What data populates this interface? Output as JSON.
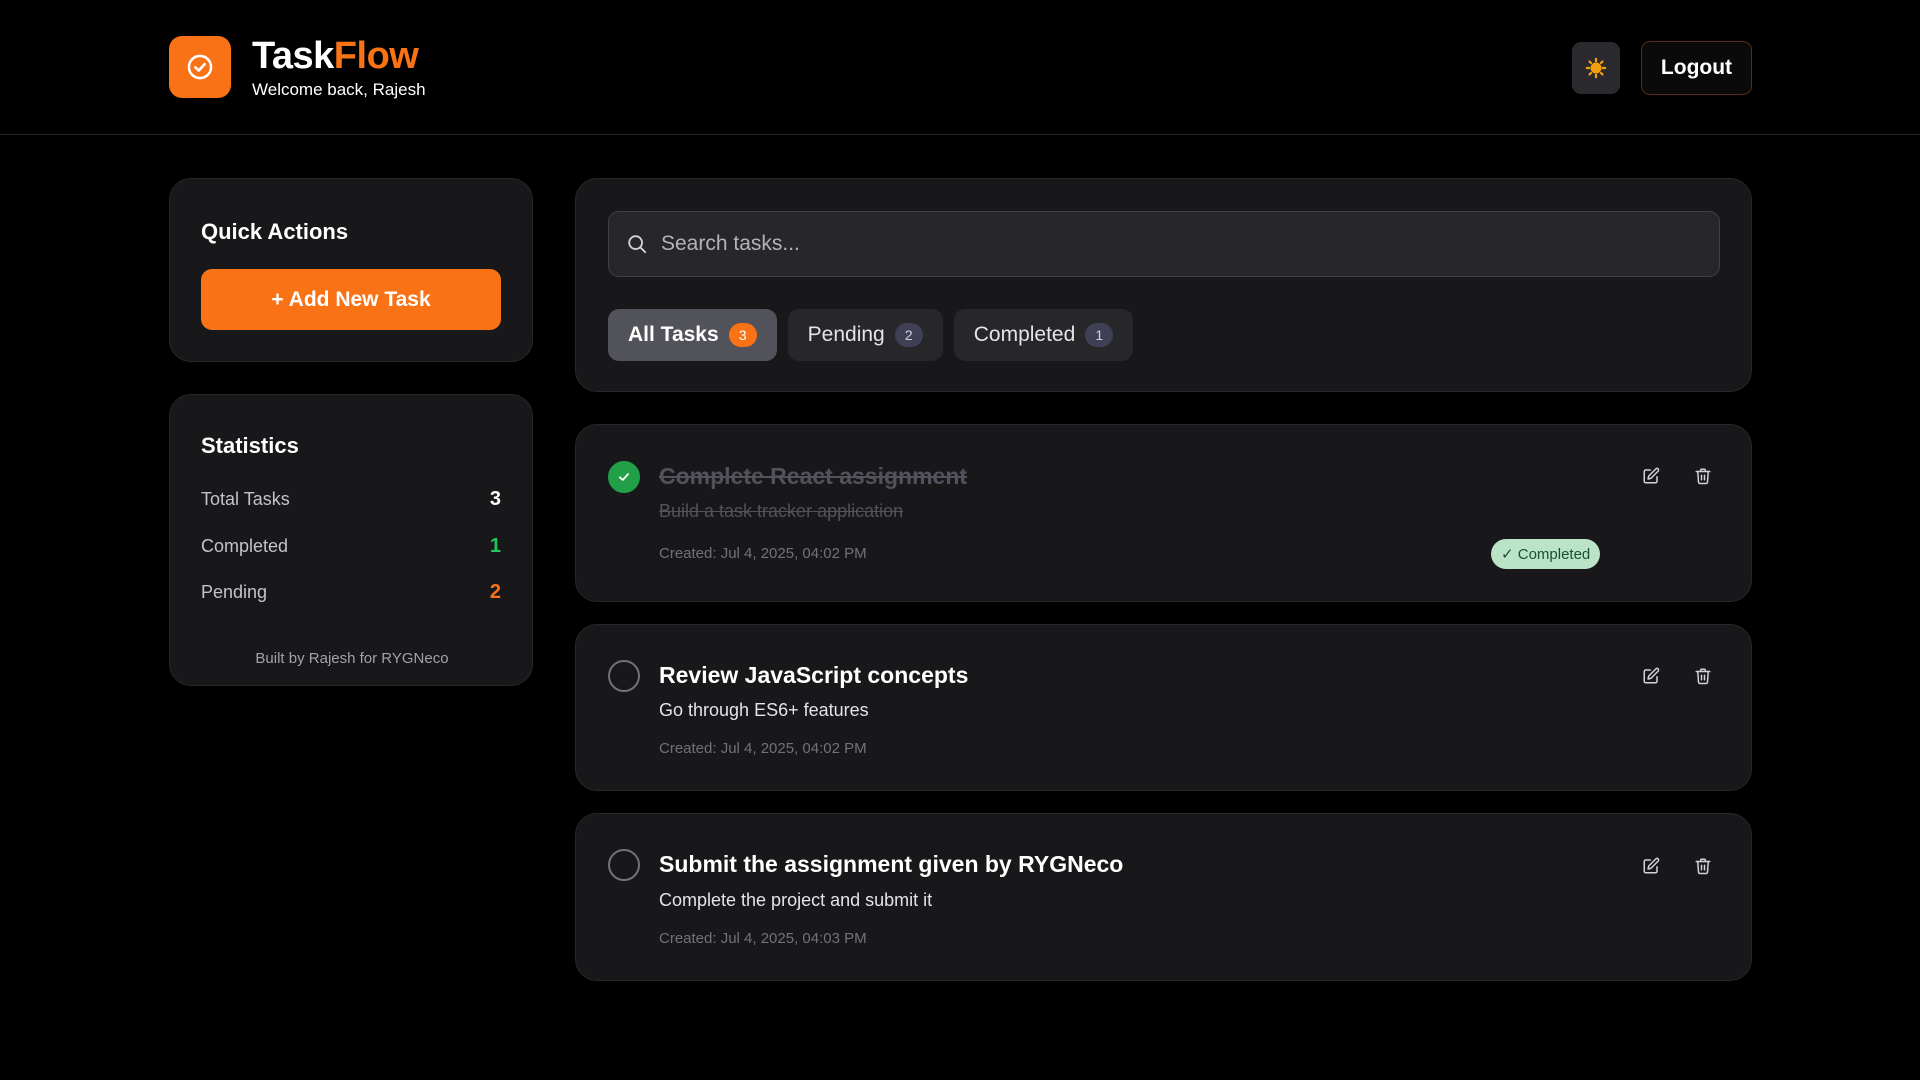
{
  "header": {
    "brand_part1": "Task",
    "brand_part2": "Flow",
    "welcome": "Welcome back, Rajesh",
    "logout_label": "Logout"
  },
  "colors": {
    "accent": "#f97316",
    "success": "#22a047",
    "background": "#000000",
    "card": "#18181b"
  },
  "sidebar": {
    "quick_actions": {
      "title": "Quick Actions",
      "add_label": "+ Add New Task"
    },
    "statistics": {
      "title": "Statistics",
      "rows": [
        {
          "label": "Total Tasks",
          "value": "3",
          "color": "#ffffff"
        },
        {
          "label": "Completed",
          "value": "1",
          "color": "#22c55e"
        },
        {
          "label": "Pending",
          "value": "2",
          "color": "#f97316"
        }
      ],
      "footer": "Built by Rajesh for RYGNeco"
    }
  },
  "search": {
    "placeholder": "Search tasks..."
  },
  "filters": [
    {
      "label": "All Tasks",
      "count": "3",
      "active": true
    },
    {
      "label": "Pending",
      "count": "2",
      "active": false
    },
    {
      "label": "Completed",
      "count": "1",
      "active": false
    }
  ],
  "tasks": [
    {
      "title": "Complete React assignment",
      "description": "Build a task tracker application",
      "created": "Created: Jul 4, 2025, 04:02 PM",
      "completed": true,
      "status_label": "✓ Completed"
    },
    {
      "title": "Review JavaScript concepts",
      "description": "Go through ES6+ features",
      "created": "Created: Jul 4, 2025, 04:02 PM",
      "completed": false
    },
    {
      "title": "Submit the assignment given by RYGNeco",
      "description": "Complete the project and submit it",
      "created": "Created: Jul 4, 2025, 04:03 PM",
      "completed": false
    }
  ],
  "icons": {
    "logo": "check-circle-icon",
    "theme": "sun-icon",
    "search": "search-icon",
    "edit": "edit-icon",
    "delete": "trash-icon"
  }
}
